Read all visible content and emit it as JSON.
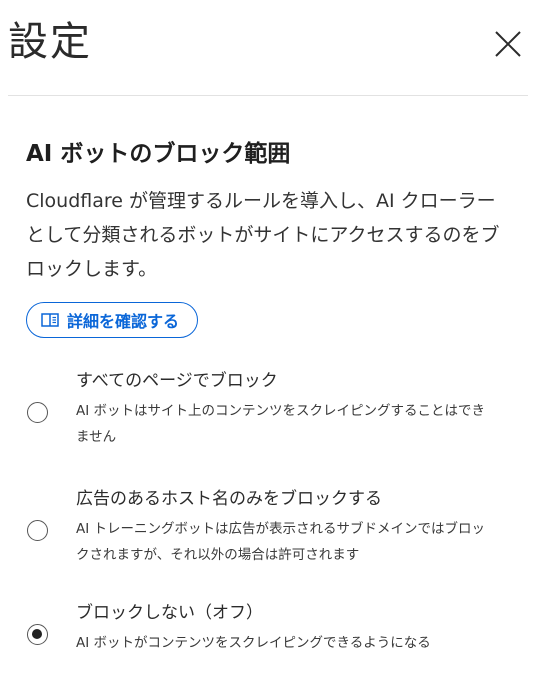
{
  "header": {
    "title": "設定"
  },
  "section": {
    "title": "AI ボットのブロック範囲",
    "description": "Cloudflare が管理するルールを導入し、AI クローラーとして分類されるボットがサイトにアクセスするのをブロックします。",
    "learn_more_label": "詳細を確認する"
  },
  "options": [
    {
      "label": "すべてのページでブロック",
      "description": "AI ボットはサイト上のコンテンツをスクレイピングすることはできません",
      "checked": false
    },
    {
      "label": "広告のあるホスト名のみをブロックする",
      "description": "AI トレーニングボットは広告が表示されるサブドメインではブロックされますが、それ以外の場合は許可されます",
      "checked": false
    },
    {
      "label": "ブロックしない（オフ）",
      "description": "AI ボットがコンテンツをスクレイピングできるようになる",
      "checked": true
    }
  ],
  "colors": {
    "accent": "#0a66d8",
    "text": "#222222",
    "divider": "#e2e2e2"
  }
}
